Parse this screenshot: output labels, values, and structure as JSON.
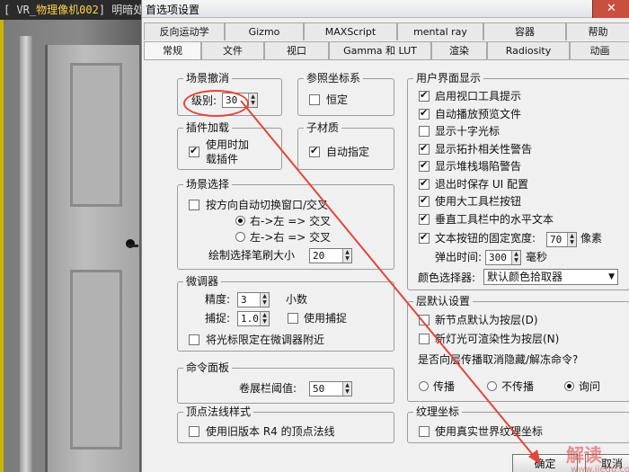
{
  "viewport": {
    "title_prefix": "[ VR_",
    "title_mid": "物理像机002",
    "title_suffix": "] 明暗处"
  },
  "dialog": {
    "title": "首选项设置",
    "close_icon": "close-icon",
    "tabs_row1": [
      "反向运动学",
      "Gizmo",
      "MAXScript",
      "mental ray",
      "容器",
      "帮助"
    ],
    "tabs_row2": [
      "常规",
      "文件",
      "视口",
      "Gamma 和 LUT",
      "渲染",
      "Radiosity",
      "动画"
    ]
  },
  "scene_undo": {
    "title": "场景撤消",
    "level_label": "级别:",
    "level_value": "30"
  },
  "ref_coord": {
    "title": "参照坐标系",
    "constant_label": "恒定",
    "constant_checked": false
  },
  "plugin_load": {
    "title": "插件加载",
    "load_on_use_label_1": "使用时加",
    "load_on_use_label_2": "载插件",
    "load_on_use_checked": true
  },
  "sub_material": {
    "title": "子材质",
    "auto_assign_label": "自动指定",
    "auto_assign_checked": true
  },
  "scene_selection": {
    "title": "场景选择",
    "auto_window_label": "按方向自动切换窗口/交叉",
    "auto_window_checked": false,
    "right_left_label": "右->左 => 交叉",
    "left_right_label": "左->右 => 交叉",
    "brush_size_label": "绘制选择笔刷大小",
    "brush_size_value": "20"
  },
  "spinners": {
    "title": "微调器",
    "precision_label": "精度:",
    "precision_value": "3",
    "precision_unit": "小数",
    "snap_label": "捕捉:",
    "snap_value": "1.0",
    "use_snap_label": "使用捕捉",
    "use_snap_checked": false,
    "cursor_limit_label": "将光标限定在微调器附近",
    "cursor_limit_checked": false
  },
  "command_panel": {
    "title": "命令面板",
    "rollup_label": "卷展栏阈值:",
    "rollup_value": "50"
  },
  "vertex_normal": {
    "title": "顶点法线样式",
    "legacy_label": "使用旧版本 R4 的顶点法线",
    "legacy_checked": false
  },
  "ui_display": {
    "title": "用户界面显示",
    "items": [
      {
        "label": "启用视口工具提示",
        "checked": true
      },
      {
        "label": "自动播放预览文件",
        "checked": true
      },
      {
        "label": "显示十字光标",
        "checked": false
      },
      {
        "label": "显示拓扑相关性警告",
        "checked": true
      },
      {
        "label": "显示堆栈塌陷警告",
        "checked": true
      },
      {
        "label": "退出时保存 UI 配置",
        "checked": true
      },
      {
        "label": "使用大工具栏按钮",
        "checked": true
      },
      {
        "label": "垂直工具栏中的水平文本",
        "checked": true
      }
    ],
    "fixed_width_label": "文本按钮的固定宽度:",
    "fixed_width_checked": true,
    "fixed_width_value": "70",
    "fixed_width_unit": "像素",
    "flyout_label": "弹出时间:",
    "flyout_value": "300",
    "flyout_unit": "毫秒",
    "color_picker_label": "颜色选择器:",
    "color_picker_value": "默认颜色拾取器"
  },
  "layer_defaults": {
    "title": "层默认设置",
    "new_node_label": "新节点默认为按层(D)",
    "new_node_checked": false,
    "new_light_label": "新灯光可渲染性为按层(N)",
    "new_light_checked": false,
    "propagate_question": "是否向层传播取消隐藏/解冻命令?",
    "opt_propagate": "传播",
    "opt_no_propagate": "不传播",
    "opt_ask": "询问"
  },
  "texture_coords": {
    "title": "纹理坐标",
    "real_world_label": "使用真实世界纹理坐标",
    "real_world_checked": false
  },
  "buttons": {
    "ok": "确定",
    "cancel": "取消"
  },
  "watermark": {
    "text": "解读",
    "url": "www.jiedu.com"
  },
  "annotation_color": "#e0463c"
}
